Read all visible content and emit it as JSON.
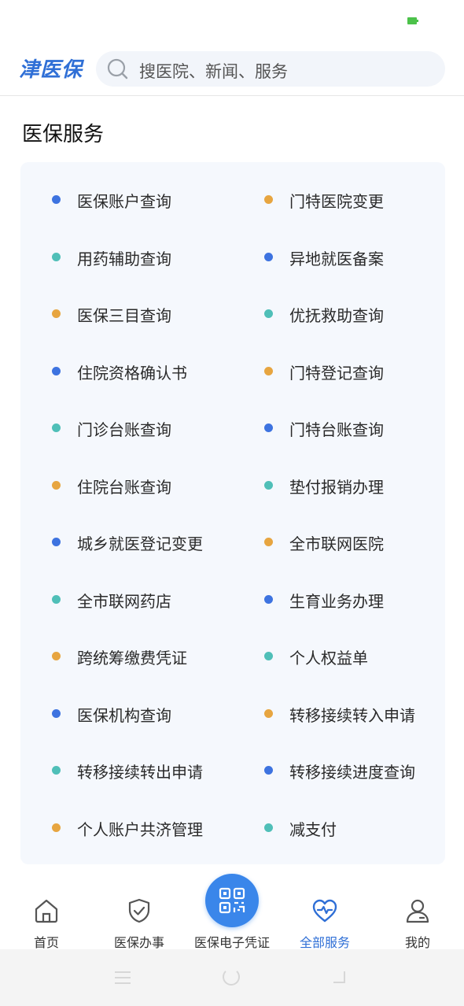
{
  "app": {
    "logo": "津医保"
  },
  "search": {
    "placeholder": "搜医院、新闻、服务"
  },
  "section": {
    "title": "医保服务"
  },
  "colors": {
    "blue": "#3d73e0",
    "orange": "#e7a540",
    "teal": "#4fbfb8",
    "accent": "#2f6fd6"
  },
  "services": [
    {
      "label": "医保账户查询",
      "color": "blue"
    },
    {
      "label": "门特医院变更",
      "color": "orange"
    },
    {
      "label": "用药辅助查询",
      "color": "teal"
    },
    {
      "label": "异地就医备案",
      "color": "blue"
    },
    {
      "label": "医保三目查询",
      "color": "orange"
    },
    {
      "label": "优抚救助查询",
      "color": "teal"
    },
    {
      "label": "住院资格确认书",
      "color": "blue"
    },
    {
      "label": "门特登记查询",
      "color": "orange"
    },
    {
      "label": "门诊台账查询",
      "color": "teal"
    },
    {
      "label": "门特台账查询",
      "color": "blue"
    },
    {
      "label": "住院台账查询",
      "color": "orange"
    },
    {
      "label": "垫付报销办理",
      "color": "teal"
    },
    {
      "label": "城乡就医登记变更",
      "color": "blue"
    },
    {
      "label": "全市联网医院",
      "color": "orange"
    },
    {
      "label": "全市联网药店",
      "color": "teal"
    },
    {
      "label": "生育业务办理",
      "color": "blue"
    },
    {
      "label": "跨统筹缴费凭证",
      "color": "orange"
    },
    {
      "label": "个人权益单",
      "color": "teal"
    },
    {
      "label": "医保机构查询",
      "color": "blue"
    },
    {
      "label": "转移接续转入申请",
      "color": "orange"
    },
    {
      "label": "转移接续转出申请",
      "color": "teal"
    },
    {
      "label": "转移接续进度查询",
      "color": "blue"
    },
    {
      "label": "个人账户共济管理",
      "color": "orange"
    },
    {
      "label": "减支付",
      "color": "teal"
    }
  ],
  "tabbar": {
    "home": "首页",
    "affairs": "医保办事",
    "voucher": "医保电子凭证",
    "all_services": "全部服务",
    "mine": "我的"
  }
}
